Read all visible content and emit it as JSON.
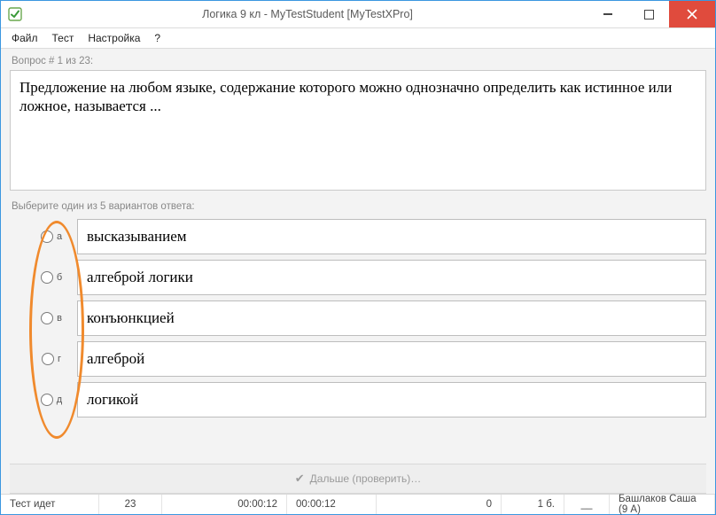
{
  "titlebar": {
    "title": "Логика 9 кл - MyTestStudent [MyTestXPro]"
  },
  "menu": {
    "file": "Файл",
    "test": "Тест",
    "settings": "Настройка",
    "help": "?"
  },
  "question": {
    "progress_label": "Вопрос # 1 из 23:",
    "text": "Предложение на любом языке, содержание которого можно однозначно определить как истинное или ложное, называется ..."
  },
  "answers": {
    "prompt": "Выберите один из 5 вариантов ответа:",
    "options": [
      {
        "letter": "а",
        "text": "высказыванием"
      },
      {
        "letter": "б",
        "text": "алгеброй логики"
      },
      {
        "letter": "в",
        "text": "конъюнкцией"
      },
      {
        "letter": "г",
        "text": "алгеброй"
      },
      {
        "letter": "д",
        "text": "логикой"
      }
    ]
  },
  "action": {
    "next_label": "Дальше (проверить)…"
  },
  "status": {
    "running": "Тест идет",
    "total": "23",
    "elapsed": "00:00:12",
    "time2": "00:00:12",
    "answered": "0",
    "points": "1 б.",
    "dash": "__",
    "user": "Башлаков Саша (9 А)"
  }
}
